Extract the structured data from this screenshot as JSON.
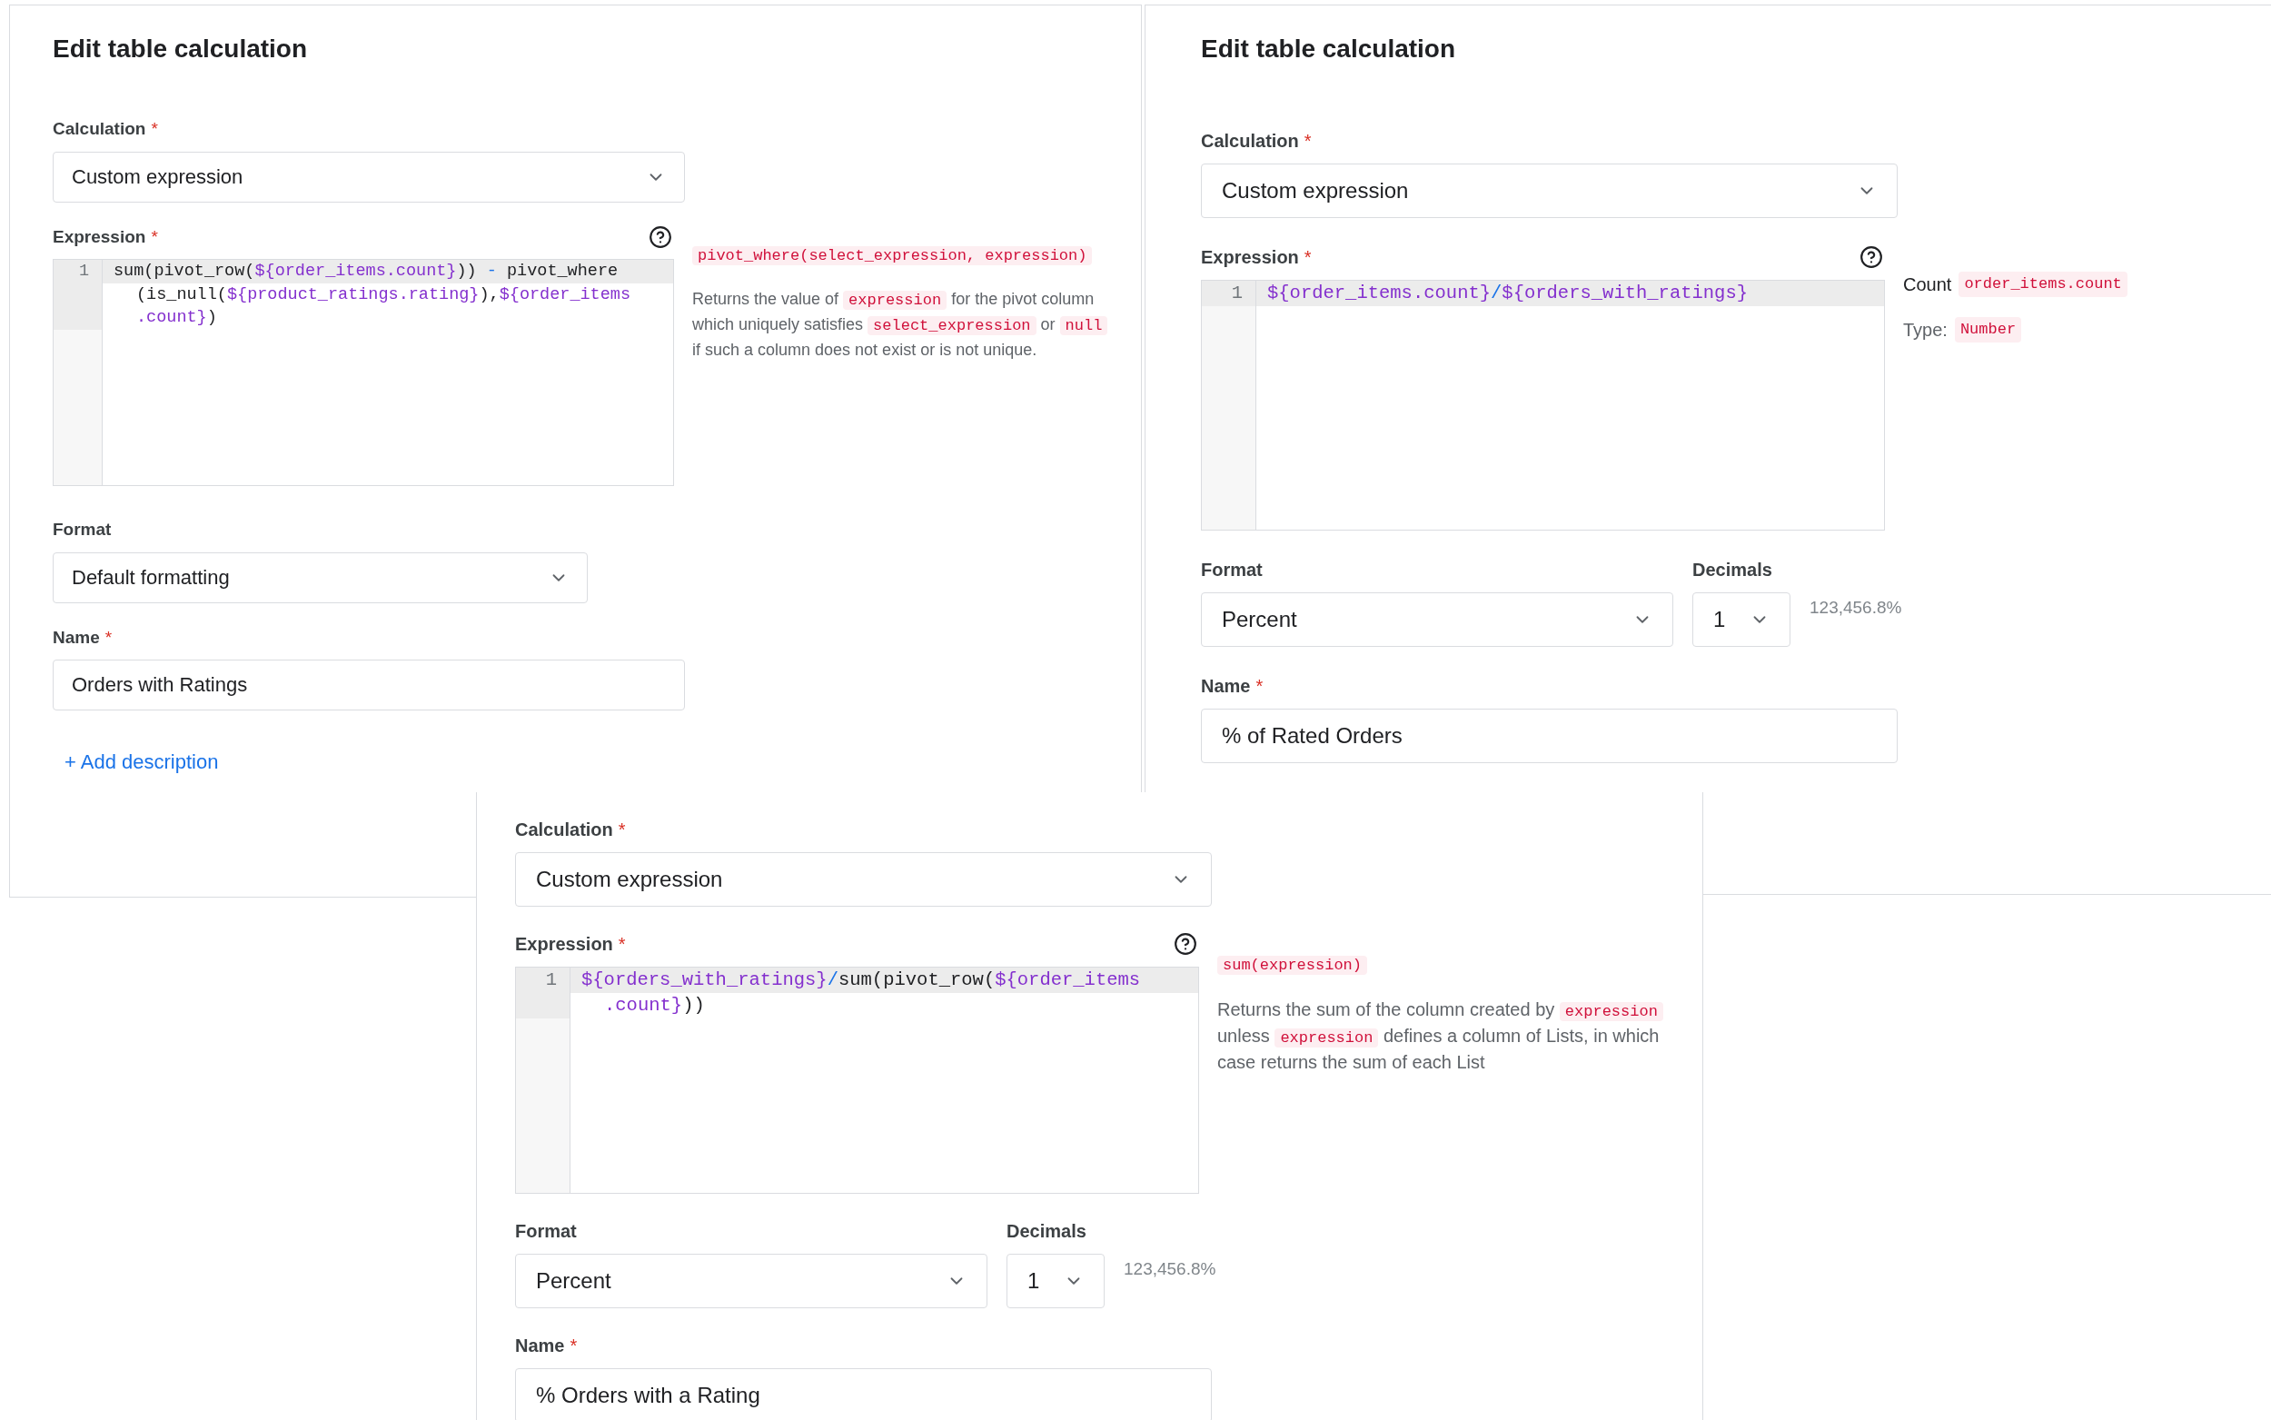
{
  "panels": [
    {
      "title": "Edit table calculation",
      "calculation": {
        "label": "Calculation",
        "required_mark": "*",
        "value": "Custom expression"
      },
      "expression": {
        "label": "Expression",
        "required_mark": "*",
        "line_number": "1",
        "rows": [
          {
            "tokens": [
              {
                "kind": "plain",
                "text": "sum(pivot_row("
              },
              {
                "kind": "field",
                "text": "${order_items.count}"
              },
              {
                "kind": "plain",
                "text": ")) "
              },
              {
                "kind": "operator",
                "text": "-"
              },
              {
                "kind": "plain",
                "text": " pivot_where"
              }
            ]
          },
          {
            "tokens": [
              {
                "kind": "plain",
                "text": "(is_null("
              },
              {
                "kind": "field",
                "text": "${product_ratings.rating}"
              },
              {
                "kind": "plain",
                "text": "),"
              },
              {
                "kind": "field",
                "text": "${order_items"
              }
            ]
          },
          {
            "tokens": [
              {
                "kind": "field",
                "text": ".count}"
              },
              {
                "kind": "plain",
                "text": ")"
              }
            ]
          }
        ]
      },
      "hint": {
        "kind": "function",
        "signature": "pivot_where(select_expression, expression)",
        "description": [
          {
            "kind": "text",
            "text": "Returns the value of "
          },
          {
            "kind": "code",
            "text": "expression"
          },
          {
            "kind": "text",
            "text": " for the pivot column which uniquely satisfies "
          },
          {
            "kind": "code",
            "text": "select_expression"
          },
          {
            "kind": "text",
            "text": " or "
          },
          {
            "kind": "code",
            "text": "null"
          },
          {
            "kind": "text",
            "text": " if such a column does not exist or is not unique."
          }
        ]
      },
      "format": {
        "label": "Format",
        "value": "Default formatting"
      },
      "name": {
        "label": "Name",
        "required_mark": "*",
        "value": "Orders with Ratings"
      },
      "add_description": "+ Add description"
    },
    {
      "title": "Edit table calculation",
      "calculation": {
        "label": "Calculation",
        "required_mark": "*",
        "value": "Custom expression"
      },
      "expression": {
        "label": "Expression",
        "required_mark": "*",
        "line_number": "1",
        "rows": [
          {
            "tokens": [
              {
                "kind": "field",
                "text": "${order_items.count}"
              },
              {
                "kind": "operator",
                "text": "/"
              },
              {
                "kind": "field",
                "text": "${orders_with_ratings}"
              }
            ]
          }
        ]
      },
      "hint": {
        "kind": "field",
        "items": [
          {
            "kind": "name",
            "label": "Count",
            "code": "order_items.count"
          },
          {
            "kind": "type",
            "label": "Type:",
            "code": "Number"
          }
        ]
      },
      "format": {
        "label": "Format",
        "value": "Percent"
      },
      "decimals": {
        "label": "Decimals",
        "value": "1"
      },
      "preview": "123,456.8%",
      "name": {
        "label": "Name",
        "required_mark": "*",
        "value": "% of Rated Orders"
      }
    },
    {
      "calculation": {
        "label": "Calculation",
        "required_mark": "*",
        "value": "Custom expression"
      },
      "expression": {
        "label": "Expression",
        "required_mark": "*",
        "line_number": "1",
        "rows": [
          {
            "tokens": [
              {
                "kind": "field",
                "text": "${orders_with_ratings}"
              },
              {
                "kind": "operator",
                "text": "/"
              },
              {
                "kind": "plain",
                "text": "sum(pivot_row("
              },
              {
                "kind": "field",
                "text": "${order_items"
              }
            ]
          },
          {
            "tokens": [
              {
                "kind": "field",
                "text": ".count}"
              },
              {
                "kind": "plain",
                "text": "))"
              }
            ]
          }
        ]
      },
      "hint": {
        "kind": "function",
        "signature": "sum(expression)",
        "description": [
          {
            "kind": "text",
            "text": "Returns the sum of the column created by "
          },
          {
            "kind": "code",
            "text": "expression"
          },
          {
            "kind": "text",
            "text": " unless "
          },
          {
            "kind": "code",
            "text": "expression"
          },
          {
            "kind": "text",
            "text": " defines a column of Lists, in which case returns the sum of each List"
          }
        ]
      },
      "format": {
        "label": "Format",
        "value": "Percent"
      },
      "decimals": {
        "label": "Decimals",
        "value": "1"
      },
      "preview": "123,456.8%",
      "name": {
        "label": "Name",
        "required_mark": "*",
        "value": "% Orders with a Rating"
      }
    }
  ]
}
